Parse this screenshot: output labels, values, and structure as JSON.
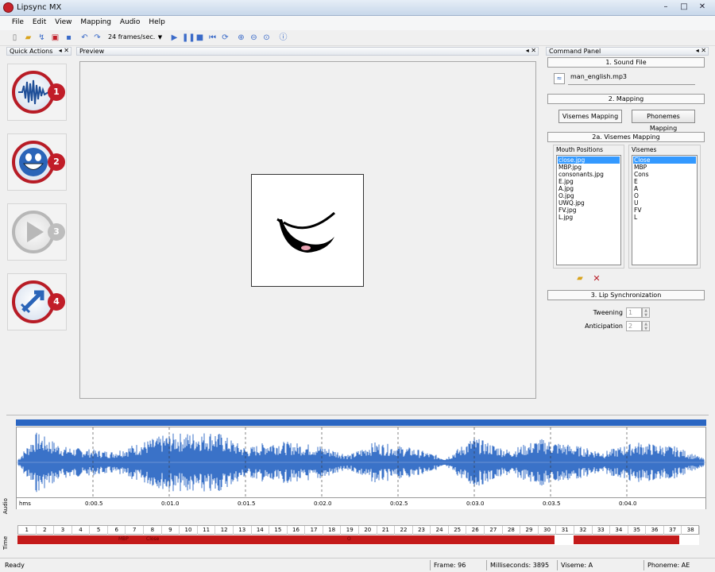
{
  "window": {
    "title": "Lipsync MX",
    "controls": [
      "–",
      "□",
      "✕"
    ]
  },
  "menu": [
    "File",
    "Edit",
    "View",
    "Mapping",
    "Audio",
    "Help"
  ],
  "toolbar": {
    "fps": "24 frames/sec."
  },
  "quick_actions": {
    "title": "Quick Actions",
    "buttons": [
      {
        "num": "1",
        "icon": "waveform-icon"
      },
      {
        "num": "2",
        "icon": "smiley-icon"
      },
      {
        "num": "3",
        "icon": "play-icon"
      },
      {
        "num": "4",
        "icon": "export-icon"
      }
    ]
  },
  "preview": {
    "title": "Preview"
  },
  "command_panel": {
    "title": "Command Panel",
    "sound_file_title": "1. Sound File",
    "sound_file": "man_english.mp3",
    "mapping_title": "2. Mapping",
    "visemes_btn": "Visemes Mapping",
    "phonemes_btn": "Phonemes Mapping",
    "visemes_mapping_title": "2a. Visemes Mapping",
    "mouth_positions_label": "Mouth Positions",
    "mouth_positions": [
      "close.jpg",
      "MBP.jpg",
      "consonants.jpg",
      "E.jpg",
      "A.jpg",
      "O.jpg",
      "UWQ.jpg",
      "FV.jpg",
      "L.jpg"
    ],
    "visemes_label": "Visemes",
    "visemes": [
      "Close",
      "MBP",
      "Cons",
      "E",
      "A",
      "O",
      "U",
      "FV",
      "L"
    ],
    "lip_sync_title": "3. Lip Synchronization",
    "tweening_label": "Tweening",
    "tweening_value": "1",
    "anticipation_label": "Anticipation",
    "anticipation_value": "2"
  },
  "audio": {
    "side_label": "Audio",
    "ruler_unit": "hms",
    "ruler_ticks": [
      "0:00.5",
      "0:01.0",
      "0:01.5",
      "0:02.0",
      "0:02.5",
      "0:03.0",
      "0:03.5",
      "0:04.0"
    ]
  },
  "timeline": {
    "side_label": "Time",
    "frames": [
      "1",
      "2",
      "3",
      "4",
      "5",
      "6",
      "7",
      "8",
      "9",
      "10",
      "11",
      "12",
      "13",
      "14",
      "15",
      "16",
      "17",
      "18",
      "19",
      "20",
      "21",
      "22",
      "23",
      "24",
      "25",
      "26",
      "27",
      "28",
      "29",
      "30",
      "31",
      "32",
      "33",
      "34",
      "35",
      "36",
      "37",
      "38"
    ],
    "phoneme_labels": [
      "MBP",
      "Close",
      "O"
    ]
  },
  "status": {
    "ready": "Ready",
    "frame": "Frame: 96",
    "ms": "Milliseconds: 3895",
    "viseme": "Viseme: A",
    "phoneme": "Phoneme: AE"
  },
  "colors": {
    "accent_red": "#c11d28",
    "wave_blue": "#3a72c8",
    "selection": "#3399ff"
  }
}
